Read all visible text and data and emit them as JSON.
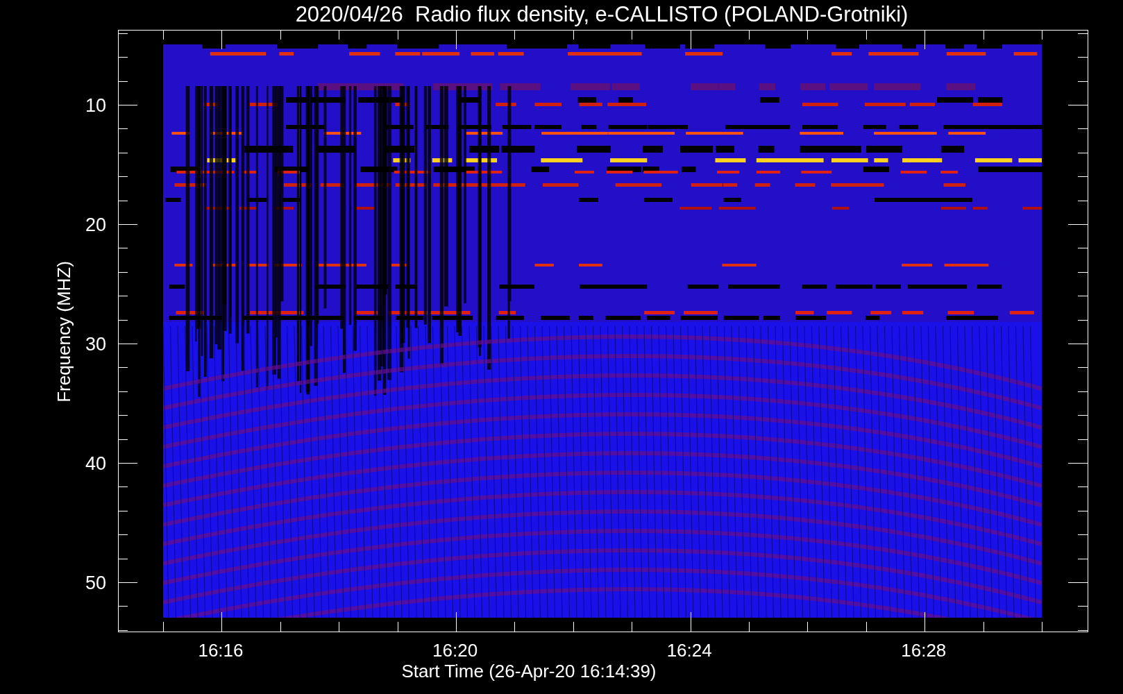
{
  "chart": {
    "title": "2020/04/26  Radio flux density, e-CALLISTO (POLAND-Grotniki)",
    "xlabel": "Start Time (26-Apr-20 16:14:39)",
    "ylabel": "Frequency (MHZ)",
    "x_ticks": [
      "16:16",
      "16:20",
      "16:24",
      "16:28"
    ],
    "y_ticks": [
      "10",
      "20",
      "30",
      "40",
      "50"
    ]
  }
}
